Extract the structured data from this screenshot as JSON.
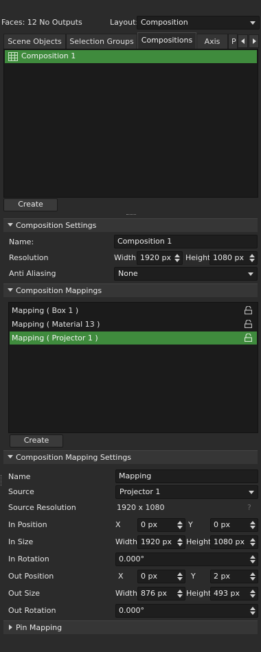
{
  "header": {
    "faces_text": "Faces: 12 No Outputs",
    "layout_label": "Layout:",
    "layout_value": "Composition"
  },
  "tabs": [
    "Scene Objects",
    "Selection Groups",
    "Compositions",
    "Axis",
    "P"
  ],
  "active_tab": "Compositions",
  "compositions_list": {
    "items": [
      "Composition 1"
    ],
    "selected": "Composition 1"
  },
  "create_label": "Create",
  "composition_settings": {
    "title": "Composition Settings",
    "name_label": "Name:",
    "name_value": "Composition 1",
    "resolution_label": "Resolution",
    "width_label": "Width",
    "width_value": "1920 px",
    "height_label": "Height",
    "height_value": "1080 px",
    "anti_aliasing_label": "Anti Aliasing",
    "anti_aliasing_value": "None"
  },
  "composition_mappings": {
    "title": "Composition Mappings",
    "items": [
      "Mapping ( Box 1 )",
      "Mapping ( Material 13 )",
      "Mapping ( Projector 1 )"
    ],
    "selected": "Mapping ( Projector 1 )",
    "create_label": "Create"
  },
  "mapping_settings": {
    "title": "Composition Mapping Settings",
    "name_label": "Name",
    "name_value": "Mapping",
    "source_label": "Source",
    "source_value": "Projector 1",
    "source_resolution_label": "Source Resolution",
    "source_resolution_value": "1920 x 1080",
    "help_glyph": "?",
    "in_position_label": "In Position",
    "in_position_x_label": "X",
    "in_position_x": "0 px",
    "in_position_y_label": "Y",
    "in_position_y": "0 px",
    "in_size_label": "In Size",
    "in_size_width_label": "Width",
    "in_size_width": "1920 px",
    "in_size_height_label": "Height",
    "in_size_height": "1080 px",
    "in_rotation_label": "In Rotation",
    "in_rotation": "0.000°",
    "out_position_label": "Out Position",
    "out_position_x_label": "X",
    "out_position_x": "0 px",
    "out_position_y_label": "Y",
    "out_position_y": "2 px",
    "out_size_label": "Out Size",
    "out_size_width_label": "Width",
    "out_size_width": "876 px",
    "out_size_height_label": "Height",
    "out_size_height": "493 px",
    "out_rotation_label": "Out Rotation",
    "out_rotation": "0.000°"
  },
  "pin_mapping": {
    "title": "Pin Mapping"
  },
  "colors": {
    "selection_green": "#3f8b3d",
    "panel_bg": "#2b2b2b",
    "field_bg": "#1e1e1e"
  }
}
